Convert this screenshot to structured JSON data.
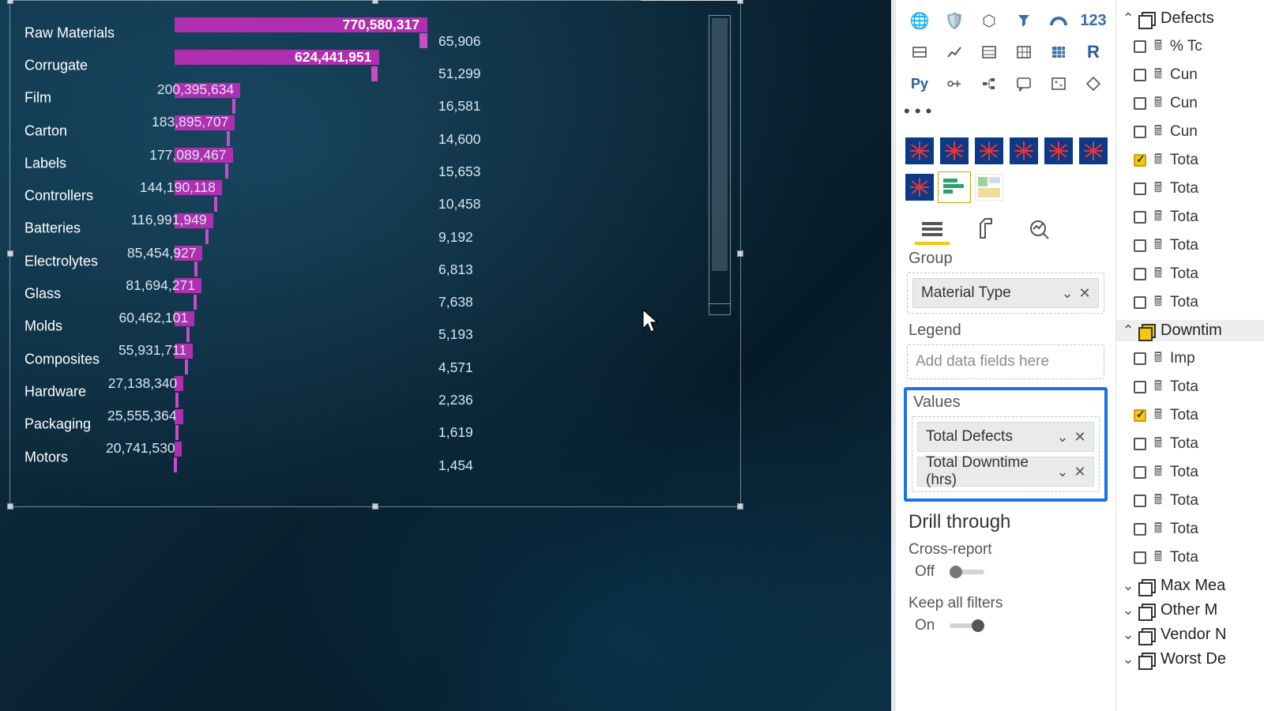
{
  "chart_data": {
    "type": "bar",
    "orientation": "horizontal",
    "group_field": "Material Type",
    "series": [
      {
        "name": "Total Defects",
        "values": [
          770580317,
          624441951,
          200395634,
          183895707,
          177089467,
          144190118,
          116991949,
          85454927,
          81694271,
          60462101,
          55931711,
          27138340,
          25555364,
          20741530
        ]
      },
      {
        "name": "Total Downtime (hrs)",
        "values": [
          65906,
          51299,
          16581,
          14600,
          15653,
          10458,
          9192,
          6813,
          7638,
          5193,
          4571,
          2236,
          1619,
          1454
        ]
      }
    ],
    "categories": [
      "Raw Materials",
      "Corrugate",
      "Film",
      "Carton",
      "Labels",
      "Controllers",
      "Batteries",
      "Electrolytes",
      "Glass",
      "Molds",
      "Composites",
      "Hardware",
      "Packaging",
      "Motors"
    ],
    "colors": {
      "Total Defects": "#b02fb0",
      "Total Downtime (hrs)": "#c84bc8"
    },
    "x_max_defects": 770580317,
    "x_max_downtime": 65906
  },
  "viz_pane": {
    "group_label": "Group",
    "group_value": "Material Type",
    "legend_label": "Legend",
    "legend_placeholder": "Add data fields here",
    "values_label": "Values",
    "values": [
      "Total Defects",
      "Total Downtime (hrs)"
    ],
    "drill_label": "Drill through",
    "cross_report_label": "Cross-report",
    "cross_report_state": "Off",
    "keep_filters_label": "Keep all filters",
    "keep_filters_state": "On"
  },
  "fields_pane": {
    "tables": [
      {
        "name": "Defects",
        "expanded": true,
        "selected": false,
        "fields": [
          {
            "name": "% Tc",
            "checked": false,
            "icon": "calc"
          },
          {
            "name": "Cun",
            "checked": false,
            "icon": "calc"
          },
          {
            "name": "Cun",
            "checked": false,
            "icon": "calc"
          },
          {
            "name": "Cun",
            "checked": false,
            "icon": "calc"
          },
          {
            "name": "Tota",
            "checked": true,
            "icon": "calc"
          },
          {
            "name": "Tota",
            "checked": false,
            "icon": "calc"
          },
          {
            "name": "Tota",
            "checked": false,
            "icon": "calc"
          },
          {
            "name": "Tota",
            "checked": false,
            "icon": "calc"
          },
          {
            "name": "Tota",
            "checked": false,
            "icon": "calc"
          },
          {
            "name": "Tota",
            "checked": false,
            "icon": "calc"
          }
        ]
      },
      {
        "name": "Downtim",
        "expanded": true,
        "selected": true,
        "fields": [
          {
            "name": "Imp",
            "checked": false,
            "icon": "calc"
          },
          {
            "name": "Tota",
            "checked": false,
            "icon": "calc"
          },
          {
            "name": "Tota",
            "checked": true,
            "icon": "calc"
          },
          {
            "name": "Tota",
            "checked": false,
            "icon": "calc"
          },
          {
            "name": "Tota",
            "checked": false,
            "icon": "calc"
          },
          {
            "name": "Tota",
            "checked": false,
            "icon": "calc"
          },
          {
            "name": "Tota",
            "checked": false,
            "icon": "calc"
          },
          {
            "name": "Tota",
            "checked": false,
            "icon": "calc"
          }
        ]
      },
      {
        "name": "Max Mea",
        "expanded": false,
        "selected": false,
        "fields": []
      },
      {
        "name": "Other M",
        "expanded": false,
        "selected": false,
        "fields": []
      },
      {
        "name": "Vendor N",
        "expanded": false,
        "selected": false,
        "fields": []
      },
      {
        "name": "Worst De",
        "expanded": false,
        "selected": false,
        "fields": []
      }
    ]
  }
}
